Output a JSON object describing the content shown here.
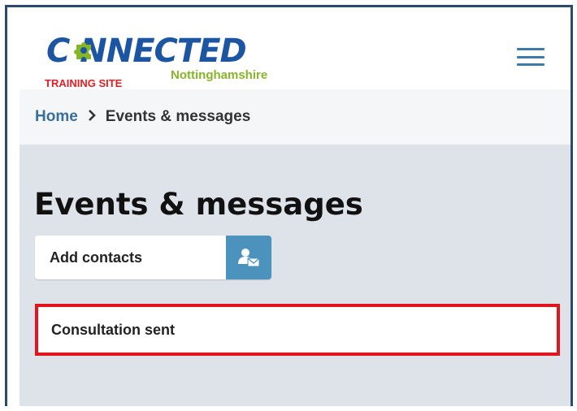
{
  "header": {
    "logo_text": "C NNECTED",
    "logo_sub": "Nottinghamshire",
    "training_label": "TRAINING SITE",
    "menu_icon": "hamburger-menu-icon"
  },
  "breadcrumb": {
    "home": "Home",
    "separator": "›",
    "current": "Events & messages"
  },
  "page": {
    "title": "Events & messages",
    "add_button_label": "Add contacts",
    "add_button_icon": "person-envelope-icon"
  },
  "items": [
    {
      "label": "Consultation sent"
    }
  ],
  "colors": {
    "brand_blue": "#1c56a3",
    "brand_green": "#86b627",
    "training_red": "#e21e24",
    "button_blue": "#4b93bc",
    "highlight_red": "#e0161e",
    "main_bg": "#dde3e8"
  }
}
